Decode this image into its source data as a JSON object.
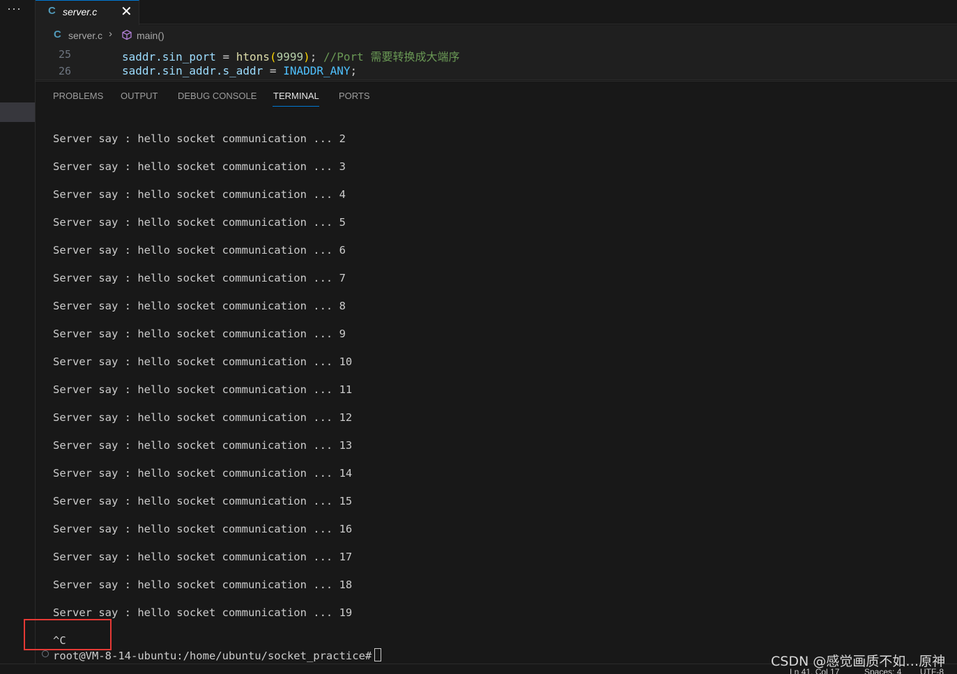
{
  "activity": {
    "more_label": "···"
  },
  "tab": {
    "icon": "C",
    "filename": "server.c",
    "close": "✕"
  },
  "breadcrumb": {
    "icon": "C",
    "file": "server.c",
    "separator": "›",
    "symbol": "main()"
  },
  "editor": {
    "lines": [
      {
        "number": "25",
        "var": "saddr.sin_port",
        "op": " = ",
        "fn": "htons",
        "open": "(",
        "num": "9999",
        "close": ")",
        "semi": "; ",
        "comment": "//Port 需要转换成大端序"
      },
      {
        "number": "26",
        "var": "saddr.sin_addr.s_addr",
        "op": " = ",
        "const": "INADDR_ANY",
        "semi": ";"
      }
    ]
  },
  "panel": {
    "tabs": [
      "PROBLEMS",
      "OUTPUT",
      "DEBUG CONSOLE",
      "TERMINAL",
      "PORTS"
    ],
    "active_tab": "TERMINAL"
  },
  "terminal": {
    "output": [
      "Server say : hello socket communication ... 2",
      "Server say : hello socket communication ... 3",
      "Server say : hello socket communication ... 4",
      "Server say : hello socket communication ... 5",
      "Server say : hello socket communication ... 6",
      "Server say : hello socket communication ... 7",
      "Server say : hello socket communication ... 8",
      "Server say : hello socket communication ... 9",
      "Server say : hello socket communication ... 10",
      "Server say : hello socket communication ... 11",
      "Server say : hello socket communication ... 12",
      "Server say : hello socket communication ... 13",
      "Server say : hello socket communication ... 14",
      "Server say : hello socket communication ... 15",
      "Server say : hello socket communication ... 16",
      "Server say : hello socket communication ... 17",
      "Server say : hello socket communication ... 18",
      "Server say : hello socket communication ... 19"
    ],
    "interrupt": "^C",
    "prompt": "root@VM-8-14-ubuntu:/home/ubuntu/socket_practice#"
  },
  "statusbar": {
    "position": "Ln 41, Col 17",
    "spaces": "Spaces: 4",
    "encoding": "UTF-8"
  },
  "watermark": "CSDN @感觉画质不如…原神",
  "colors": {
    "accent": "#0078d4",
    "highlight_box": "#e53935"
  }
}
